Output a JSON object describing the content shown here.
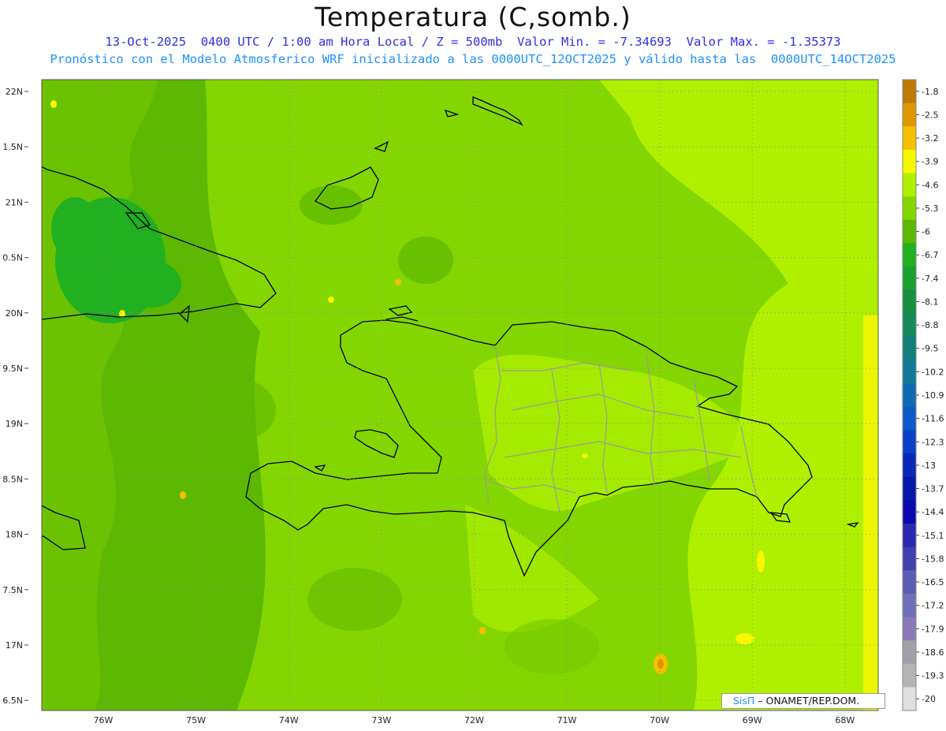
{
  "title": "Temperatura (C,somb.)",
  "subtitle_line1": "13-Oct-2025  0400 UTC / 1:00 am Hora Local / Z = 500mb  Valor Min. = -7.34693  Valor Max. = -1.35373",
  "subtitle_line2": "Pronóstico con el Modelo Atmosferico WRF inicializado a las 0000UTC_12OCT2025 y válido hasta las  0000UTC_14OCT2025",
  "lat_labels": [
    "22N",
    "1.5N",
    "21N",
    "0.5N",
    "20N",
    "9.5N",
    "19N",
    "8.5N",
    "18N",
    "7.5N",
    "17N",
    "6.5N"
  ],
  "lon_labels": [
    "76W",
    "75W",
    "74W",
    "73W",
    "72W",
    "71W",
    "70W",
    "69W",
    "68W"
  ],
  "colorbar": {
    "labels": [
      "-1.8",
      "-2.5",
      "-3.2",
      "-3.9",
      "-4.6",
      "-5.3",
      "-6",
      "-6.7",
      "-7.4",
      "-8.1",
      "-8.8",
      "-9.5",
      "-10.2",
      "-10.9",
      "-11.6",
      "-12.3",
      "-13",
      "-13.7",
      "-14.4",
      "-15.1",
      "-15.8",
      "-16.5",
      "-17.2",
      "-17.9",
      "-18.6",
      "-19.3",
      "-20"
    ],
    "colors": [
      "#c07a00",
      "#e09600",
      "#f4c000",
      "#f7f700",
      "#aef000",
      "#84d600",
      "#5cb800",
      "#20b020",
      "#18a030",
      "#169040",
      "#148a5a",
      "#12807a",
      "#107a96",
      "#0e6ab4",
      "#0c5ac8",
      "#0a40c8",
      "#0828b8",
      "#0618a8",
      "#0a0ab0",
      "#2a2ab0",
      "#4040b0",
      "#5c5cb4",
      "#7070b8",
      "#8a7ab8",
      "#a0a0a8",
      "#b4b4b4",
      "#e0e0e0"
    ]
  },
  "credit": {
    "brand": "SisΠ",
    "text": " – ONAMET/REP.DOM."
  }
}
